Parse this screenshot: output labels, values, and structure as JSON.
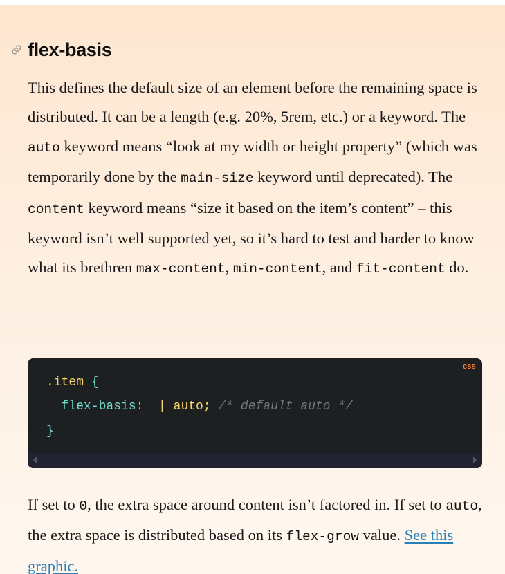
{
  "section": {
    "title": "flex-basis",
    "anchor_icon": "link-icon"
  },
  "para1": {
    "t1": "This defines the default size of an element before the remaining space is distributed. It can be a length (e.g. 20%, 5rem, etc.) or a keyword. The ",
    "c1": "auto",
    "t2": " keyword means “look at my width or height property” (which was temporarily done by the ",
    "c2": "main-size",
    "t3": " keyword until deprecated). The ",
    "c3": "content",
    "t4": " keyword means “size it based on the item’s content” – this keyword isn’t well supported yet, so it’s hard to test and harder to know what its brethren ",
    "c4": "max-content",
    "t5": ", ",
    "c5": "min-content",
    "t6": ", and ",
    "c6": "fit-content",
    "t7": " do."
  },
  "code": {
    "language": "css",
    "selector": ".item",
    "open_brace": " {",
    "property": "flex-basis:",
    "separator": "| ",
    "value": "auto",
    "semicolon": ";",
    "comment": "/* default auto */",
    "close_brace": "}"
  },
  "para2": {
    "t1": "If set to ",
    "c1": "0",
    "t2": ", the extra space around content isn’t factored in. If set to ",
    "c2": "auto",
    "t3": ", the extra space is distributed based on its ",
    "c3": "flex-grow",
    "t4": " value. ",
    "link": "See this graphic."
  },
  "colors": {
    "accent_link": "#2a7fb8",
    "code_bg": "#1d1f21",
    "lang_badge": "#f0803c",
    "code_yellow": "#f5d76e",
    "code_teal": "#6fe0d3"
  }
}
